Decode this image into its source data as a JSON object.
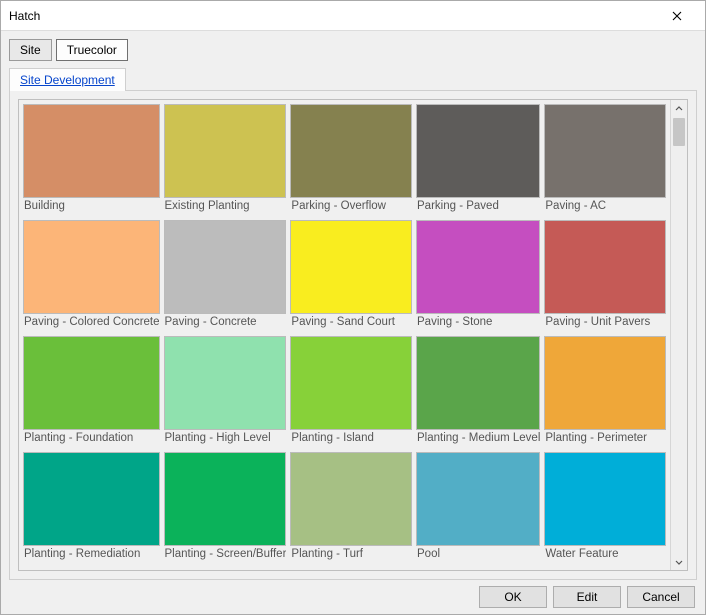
{
  "window": {
    "title": "Hatch"
  },
  "tabs": {
    "site": "Site",
    "truecolor": "Truecolor",
    "active": "Truecolor"
  },
  "subtab": {
    "label": "Site Development"
  },
  "footer": {
    "ok": "OK",
    "edit": "Edit",
    "cancel": "Cancel"
  },
  "swatches": [
    {
      "label": "Building",
      "color": "#d58e66"
    },
    {
      "label": "Existing Planting",
      "color": "#cdc251"
    },
    {
      "label": "Parking - Overflow",
      "color": "#85814f"
    },
    {
      "label": "Parking - Paved",
      "color": "#5e5c5a"
    },
    {
      "label": "Paving - AC",
      "color": "#77716c"
    },
    {
      "label": "Paving - Colored Concrete",
      "color": "#fcb578"
    },
    {
      "label": "Paving - Concrete",
      "color": "#bcbcbc"
    },
    {
      "label": "Paving - Sand Court",
      "color": "#f9ed1f"
    },
    {
      "label": "Paving - Stone",
      "color": "#c54ec0"
    },
    {
      "label": "Paving - Unit Pavers",
      "color": "#c55a56"
    },
    {
      "label": "Planting - Foundation",
      "color": "#6abf3a"
    },
    {
      "label": "Planting - High Level",
      "color": "#8fe1ae"
    },
    {
      "label": "Planting - Island",
      "color": "#87d139"
    },
    {
      "label": "Planting - Medium Level",
      "color": "#5aa54a"
    },
    {
      "label": "Planting - Perimeter",
      "color": "#efa739"
    },
    {
      "label": "Planting - Remediation",
      "color": "#00a588"
    },
    {
      "label": "Planting - Screen/Buffer",
      "color": "#0bb25a"
    },
    {
      "label": "Planting - Turf",
      "color": "#a6c084"
    },
    {
      "label": "Pool",
      "color": "#52aec6"
    },
    {
      "label": "Water Feature",
      "color": "#00aed8"
    }
  ]
}
